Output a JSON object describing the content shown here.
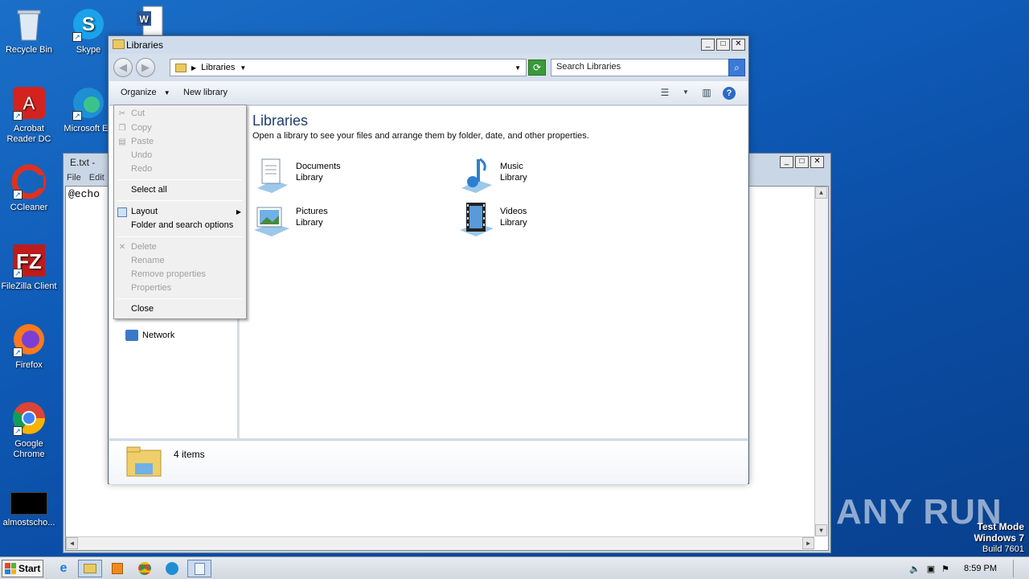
{
  "desktop": {
    "icons": [
      {
        "label": "Recycle Bin",
        "icon": "recycle-bin-icon"
      },
      {
        "label": "Skype",
        "icon": "skype-icon"
      },
      {
        "label": "Acrobat Reader DC",
        "icon": "acrobat-icon"
      },
      {
        "label": "Microsoft Ed",
        "icon": "edge-icon"
      },
      {
        "label": "CCleaner",
        "icon": "ccleaner-icon"
      },
      {
        "label": "FileZilla Client",
        "icon": "filezilla-icon"
      },
      {
        "label": "Firefox",
        "icon": "firefox-icon"
      },
      {
        "label": "Google Chrome",
        "icon": "chrome-icon"
      },
      {
        "label": "almostscho...",
        "icon": "file-icon"
      }
    ]
  },
  "notepad": {
    "title": "E.txt -",
    "menu": [
      "File",
      "Edit"
    ],
    "content": "@echo"
  },
  "explorer": {
    "title": "Libraries",
    "address": "Libraries",
    "search_placeholder": "Search Libraries",
    "toolbar": {
      "organize": "Organize",
      "new_library": "New library"
    },
    "navpane": {
      "network": "Network"
    },
    "heading": "Libraries",
    "subheading": "Open a library to see your files and arrange them by folder, date, and other properties.",
    "libraries": [
      {
        "name": "Documents",
        "type": "Library",
        "icon": "documents-library-icon"
      },
      {
        "name": "Music",
        "type": "Library",
        "icon": "music-library-icon"
      },
      {
        "name": "Pictures",
        "type": "Library",
        "icon": "pictures-library-icon"
      },
      {
        "name": "Videos",
        "type": "Library",
        "icon": "videos-library-icon"
      }
    ],
    "details": {
      "count": "4 items"
    }
  },
  "organize_menu": {
    "items": [
      {
        "label": "Cut",
        "enabled": false
      },
      {
        "label": "Copy",
        "enabled": false
      },
      {
        "label": "Paste",
        "enabled": false
      },
      {
        "label": "Undo",
        "enabled": false
      },
      {
        "label": "Redo",
        "enabled": false
      },
      {
        "label": "Select all",
        "enabled": true
      },
      {
        "label": "Layout",
        "enabled": true,
        "submenu": true
      },
      {
        "label": "Folder and search options",
        "enabled": true
      },
      {
        "label": "Delete",
        "enabled": false
      },
      {
        "label": "Rename",
        "enabled": false
      },
      {
        "label": "Remove properties",
        "enabled": false
      },
      {
        "label": "Properties",
        "enabled": false
      },
      {
        "label": "Close",
        "enabled": true
      }
    ]
  },
  "taskbar": {
    "start": "Start",
    "clock": "8:59 PM",
    "pinned": [
      "ie-icon",
      "explorer-icon",
      "media-player-icon",
      "chrome-icon",
      "edge-icon",
      "notepad-icon"
    ]
  },
  "watermark": "ANY RUN",
  "test_mode": {
    "line1": "Test Mode",
    "line2": "Windows 7",
    "line3": "Build 7601"
  }
}
